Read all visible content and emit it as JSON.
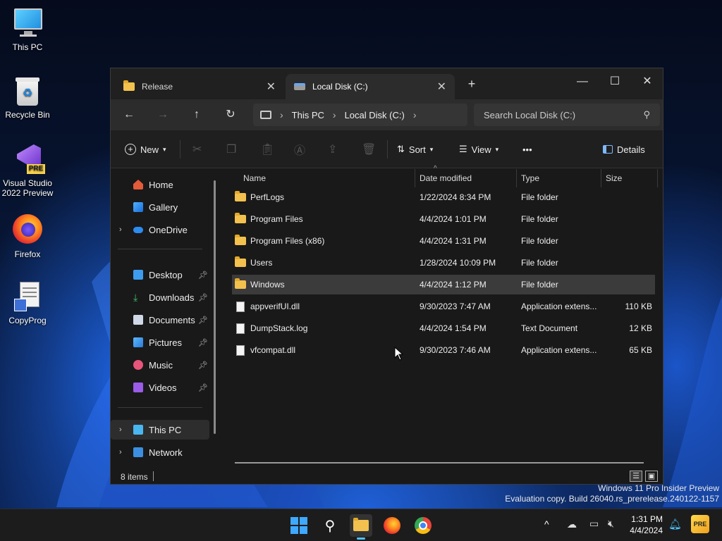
{
  "desktop": {
    "icons": [
      {
        "label": "This PC",
        "icon": "monitor-icon"
      },
      {
        "label": "Recycle Bin",
        "icon": "recycle-bin-icon"
      },
      {
        "label": "Visual Studio 2022 Preview",
        "icon": "visual-studio-icon",
        "badge": "PRE"
      },
      {
        "label": "Firefox",
        "icon": "firefox-icon"
      },
      {
        "label": "CopyProg",
        "icon": "copyprog-icon"
      }
    ],
    "watermark_line1": "Windows 11 Pro Insider Preview",
    "watermark_line2": "Evaluation copy. Build 26040.rs_prerelease.240122-1157"
  },
  "window": {
    "tabs": [
      {
        "label": "Release",
        "active": false
      },
      {
        "label": "Local Disk (C:)",
        "active": true
      }
    ],
    "new_tab": "+",
    "controls": {
      "minimize": "—",
      "maximize": "☐",
      "close": "✕"
    }
  },
  "nav": {
    "breadcrumb": [
      "This PC",
      "Local Disk (C:)"
    ],
    "search_placeholder": "Search Local Disk (C:)"
  },
  "toolbar": {
    "new_label": "New",
    "sort_label": "Sort",
    "view_label": "View",
    "more_label": "•••",
    "details_label": "Details"
  },
  "sidebar": {
    "top": [
      {
        "label": "Home",
        "icon": "home-icon"
      },
      {
        "label": "Gallery",
        "icon": "gallery-icon"
      },
      {
        "label": "OneDrive",
        "icon": "onedrive-icon"
      }
    ],
    "pinned": [
      {
        "label": "Desktop",
        "icon": "desktop-icon"
      },
      {
        "label": "Downloads",
        "icon": "downloads-icon"
      },
      {
        "label": "Documents",
        "icon": "documents-icon"
      },
      {
        "label": "Pictures",
        "icon": "pictures-icon"
      },
      {
        "label": "Music",
        "icon": "music-icon"
      },
      {
        "label": "Videos",
        "icon": "videos-icon"
      }
    ],
    "bottom": [
      {
        "label": "This PC",
        "icon": "this-pc-icon"
      },
      {
        "label": "Network",
        "icon": "network-icon"
      }
    ]
  },
  "columns": {
    "name": "Name",
    "date": "Date modified",
    "type": "Type",
    "size": "Size"
  },
  "files": [
    {
      "name": "PerfLogs",
      "date": "1/22/2024 8:34 PM",
      "type": "File folder",
      "size": "",
      "kind": "folder"
    },
    {
      "name": "Program Files",
      "date": "4/4/2024 1:01 PM",
      "type": "File folder",
      "size": "",
      "kind": "folder"
    },
    {
      "name": "Program Files (x86)",
      "date": "4/4/2024 1:31 PM",
      "type": "File folder",
      "size": "",
      "kind": "folder"
    },
    {
      "name": "Users",
      "date": "1/28/2024 10:09 PM",
      "type": "File folder",
      "size": "",
      "kind": "folder"
    },
    {
      "name": "Windows",
      "date": "4/4/2024 1:12 PM",
      "type": "File folder",
      "size": "",
      "kind": "folder"
    },
    {
      "name": "appverifUI.dll",
      "date": "9/30/2023 7:47 AM",
      "type": "Application extens...",
      "size": "110 KB",
      "kind": "file"
    },
    {
      "name": "DumpStack.log",
      "date": "4/4/2024 1:54 PM",
      "type": "Text Document",
      "size": "12 KB",
      "kind": "file"
    },
    {
      "name": "vfcompat.dll",
      "date": "9/30/2023 7:46 AM",
      "type": "Application extens...",
      "size": "65 KB",
      "kind": "file"
    }
  ],
  "status": {
    "item_count": "8 items"
  },
  "taskbar": {
    "time": "1:31 PM",
    "date": "4/4/2024"
  }
}
